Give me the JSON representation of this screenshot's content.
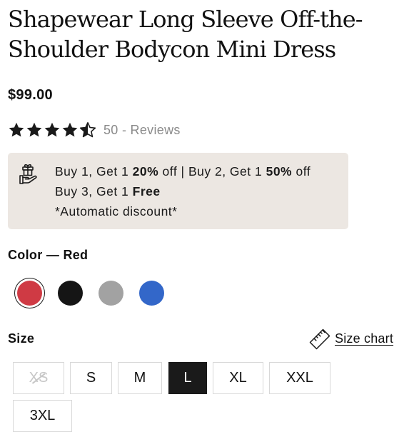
{
  "product": {
    "title_line1": "Shapewear Long Sleeve Off-the-",
    "title_line2": "Shoulder Bodycon Mini Dress",
    "price": "$99.00",
    "rating": 4.5,
    "review_count": "50",
    "review_separator": "-",
    "review_label": "Reviews"
  },
  "promo": {
    "icon": "gift-hand-icon",
    "line1": {
      "t1": "Buy 1, Get 1 ",
      "b1": "20%",
      "t2": " off | Buy 2, Get 1 ",
      "b2": "50%",
      "t3": " off"
    },
    "line2": {
      "t1": "Buy 3, Get 1 ",
      "b1": "Free"
    },
    "line3": "*Automatic discount*"
  },
  "color": {
    "label": "Color",
    "separator": "—",
    "selected": "Red",
    "swatches": [
      {
        "name": "Red",
        "hex": "#cf3a44"
      },
      {
        "name": "Black",
        "hex": "#151515"
      },
      {
        "name": "Grey",
        "hex": "#a2a2a2"
      },
      {
        "name": "Blue",
        "hex": "#3367c9"
      }
    ]
  },
  "size": {
    "label": "Size",
    "chart_link": "Size chart",
    "chart_icon": "ruler-icon",
    "options": [
      {
        "label": "XS",
        "available": false,
        "selected": false
      },
      {
        "label": "S",
        "available": true,
        "selected": false
      },
      {
        "label": "M",
        "available": true,
        "selected": false
      },
      {
        "label": "L",
        "available": true,
        "selected": true
      },
      {
        "label": "XL",
        "available": true,
        "selected": false
      },
      {
        "label": "XXL",
        "available": true,
        "selected": false
      },
      {
        "label": "3XL",
        "available": true,
        "selected": false
      }
    ]
  }
}
